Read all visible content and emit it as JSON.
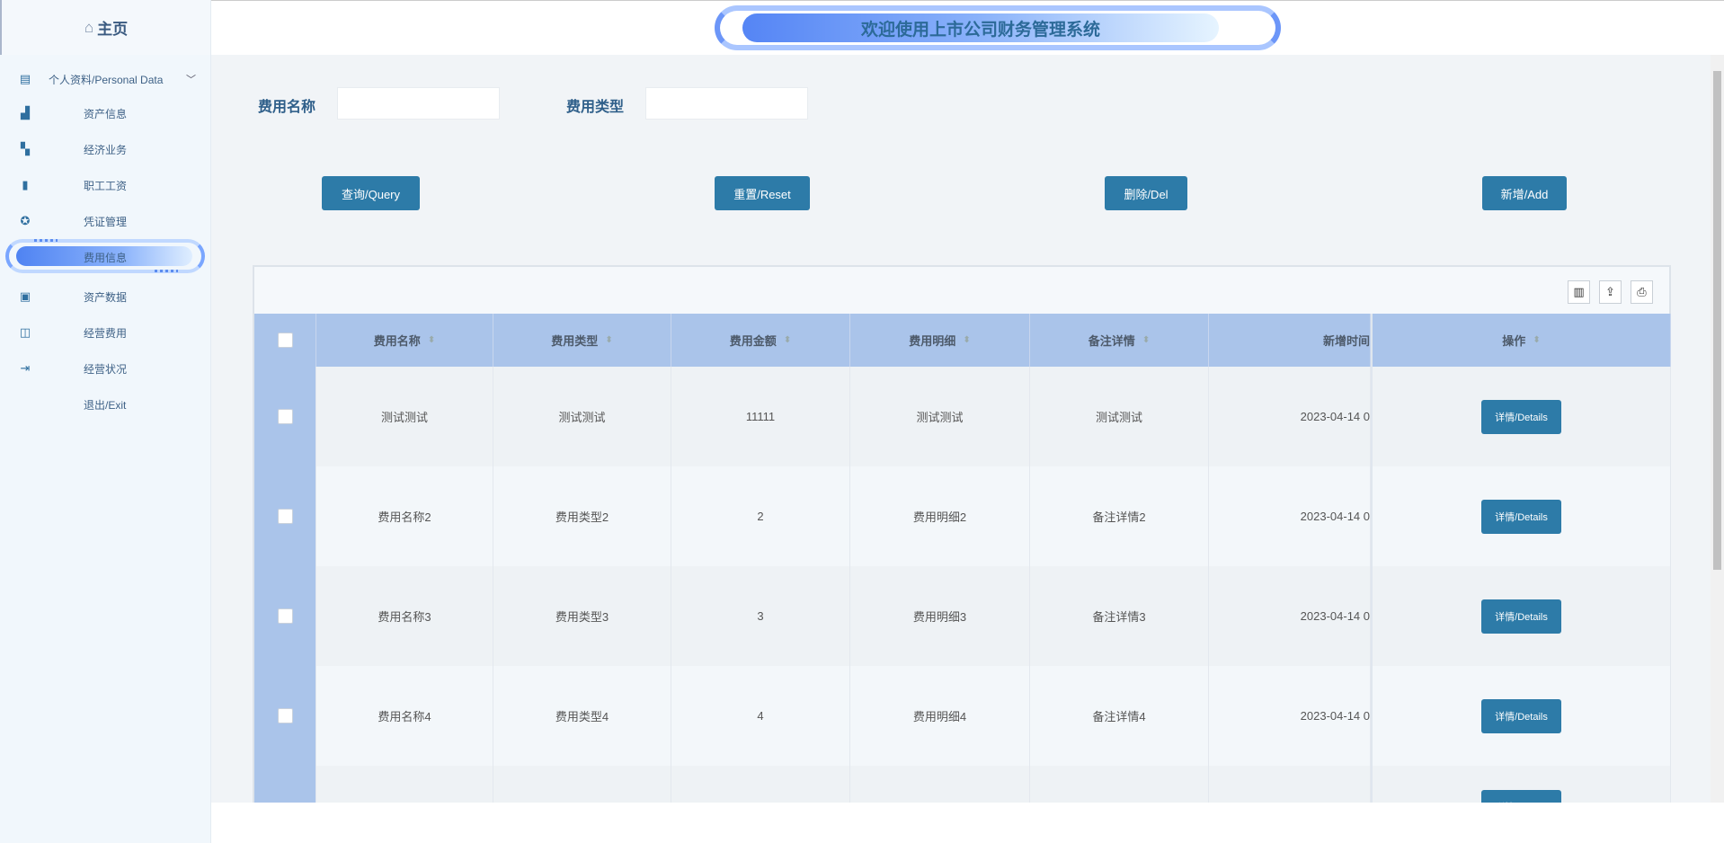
{
  "sidebar": {
    "home": "主页",
    "items": [
      {
        "label": "个人资料/Personal Data",
        "icon": "document-icon"
      },
      {
        "label": "资产信息",
        "icon": "bar-chart-icon"
      },
      {
        "label": "经济业务",
        "icon": "trend-chart-icon"
      },
      {
        "label": "职工工资",
        "icon": "bookmark-icon"
      },
      {
        "label": "凭证管理",
        "icon": "badge-icon"
      },
      {
        "label": "费用信息",
        "icon": ""
      },
      {
        "label": "资产数据",
        "icon": "calendar-check-icon"
      },
      {
        "label": "经营费用",
        "icon": "book-icon"
      },
      {
        "label": "经营状况",
        "icon": "logout-icon"
      },
      {
        "label": "退出/Exit",
        "icon": ""
      }
    ],
    "active": "费用信息"
  },
  "header": {
    "title": "欢迎使用上市公司财务管理系统"
  },
  "search": {
    "name_label": "费用名称",
    "name_value": "",
    "type_label": "费用类型",
    "type_value": ""
  },
  "buttons": {
    "query": "查询/Query",
    "reset": "重置/Reset",
    "del": "删除/Del",
    "add": "新增/Add"
  },
  "table": {
    "columns": [
      "费用名称",
      "费用类型",
      "费用金额",
      "费用明细",
      "备注详情",
      "新增时间",
      "操作"
    ],
    "details_label": "详情/Details",
    "rows": [
      [
        "测试测试",
        "测试测试",
        "11111",
        "测试测试",
        "测试测试",
        "2023-04-14 0"
      ],
      [
        "费用名称2",
        "费用类型2",
        "2",
        "费用明细2",
        "备注详情2",
        "2023-04-14 0"
      ],
      [
        "费用名称3",
        "费用类型3",
        "3",
        "费用明细3",
        "备注详情3",
        "2023-04-14 0"
      ],
      [
        "费用名称4",
        "费用类型4",
        "4",
        "费用明细4",
        "备注详情4",
        "2023-04-14 0"
      ]
    ]
  },
  "colors": {
    "primary": "#2d7ba8",
    "header_bg": "#aac4ea",
    "title": "#2c6a98"
  }
}
